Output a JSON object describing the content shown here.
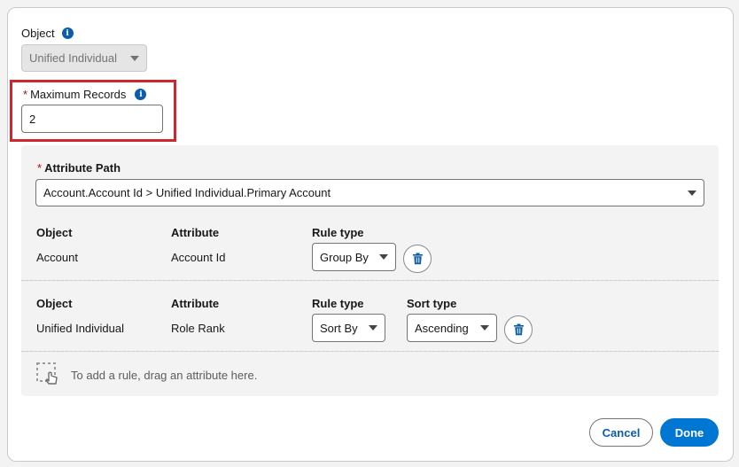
{
  "object_field": {
    "label": "Object",
    "value": "Unified Individual"
  },
  "max_records": {
    "required_marker": "*",
    "label": "Maximum Records",
    "value": "2"
  },
  "attribute_path": {
    "required_marker": "*",
    "label": "Attribute Path",
    "value": "Account.Account Id > Unified Individual.Primary Account"
  },
  "rules": [
    {
      "headers": {
        "object": "Object",
        "attribute": "Attribute",
        "rule_type": "Rule type"
      },
      "object": "Account",
      "attribute": "Account Id",
      "rule_type": "Group By"
    },
    {
      "headers": {
        "object": "Object",
        "attribute": "Attribute",
        "rule_type": "Rule type",
        "sort_type": "Sort type"
      },
      "object": "Unified Individual",
      "attribute": "Role Rank",
      "rule_type": "Sort By",
      "sort_type": "Ascending"
    }
  ],
  "drop_hint": "To add a rule, drag an attribute here.",
  "footer": {
    "cancel_label": "Cancel",
    "done_label": "Done"
  },
  "colors": {
    "brand": "#0176d3",
    "highlight": "#d0262d",
    "required": "#ba0517"
  },
  "icons": {
    "info": "info-icon",
    "trash": "trash-icon",
    "drag": "drag-drop-icon"
  }
}
